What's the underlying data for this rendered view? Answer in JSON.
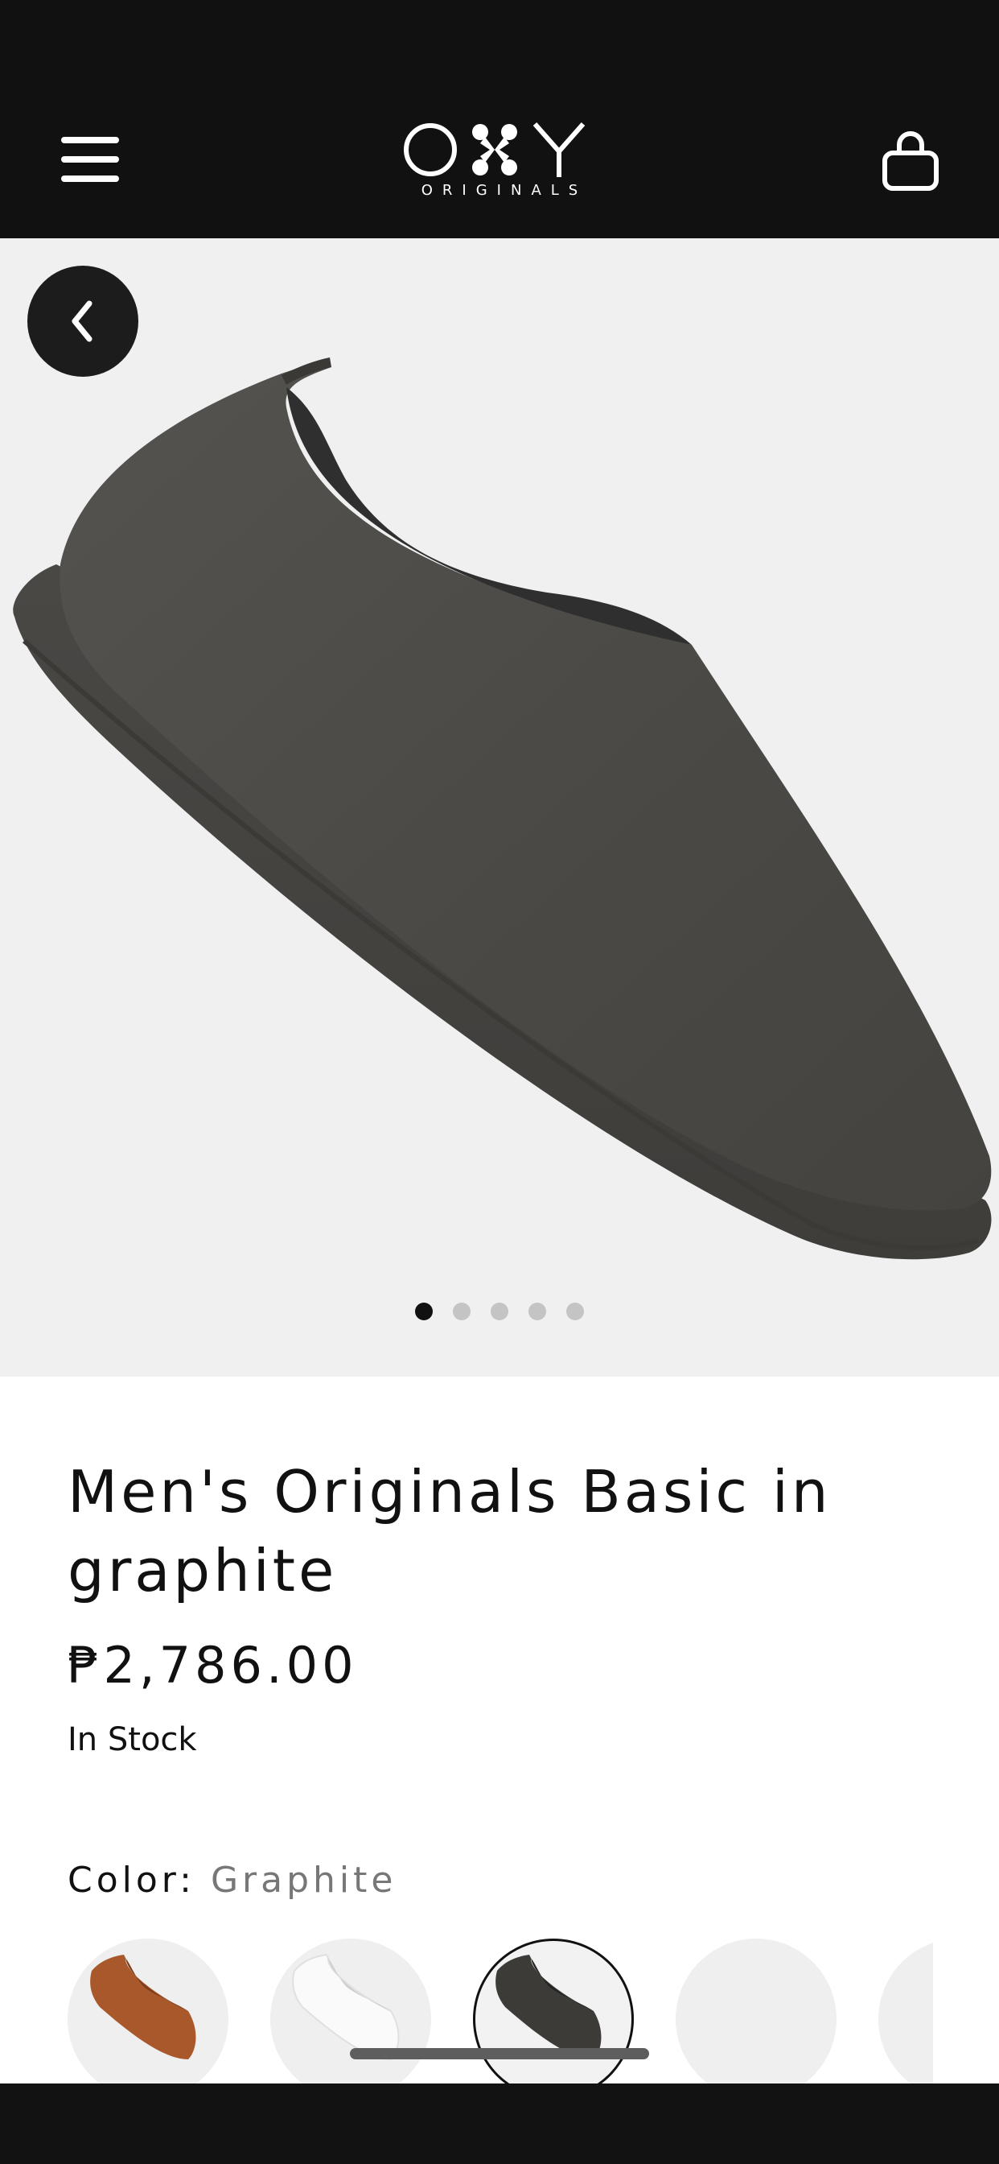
{
  "header": {
    "logo_text": "OXY",
    "logo_subtext": "ORIGINALS",
    "menu_icon": "hamburger-menu-icon",
    "cart_icon": "shopping-bag-icon"
  },
  "gallery": {
    "back_icon": "chevron-left-icon",
    "image_subject": "graphite slip-on shoe",
    "total_images": 5,
    "active_index": 0
  },
  "product": {
    "title": "Men's Originals Basic in graphite",
    "price": "₱2,786.00",
    "stock_status": "In Stock",
    "color_label": "Color:",
    "color_value": "Graphite",
    "swatches": [
      {
        "color": "#a9582b",
        "selected": false
      },
      {
        "color": "#f5f5f5",
        "selected": false
      },
      {
        "color": "#3c3b38",
        "selected": true
      },
      {
        "color": "#efefef",
        "selected": false
      },
      {
        "color": "#efefef",
        "selected": false
      }
    ]
  },
  "colors": {
    "header_bg": "#111111",
    "hero_bg": "#f0f0f0",
    "shoe_color": "#4a4845",
    "accent": "#111111"
  }
}
